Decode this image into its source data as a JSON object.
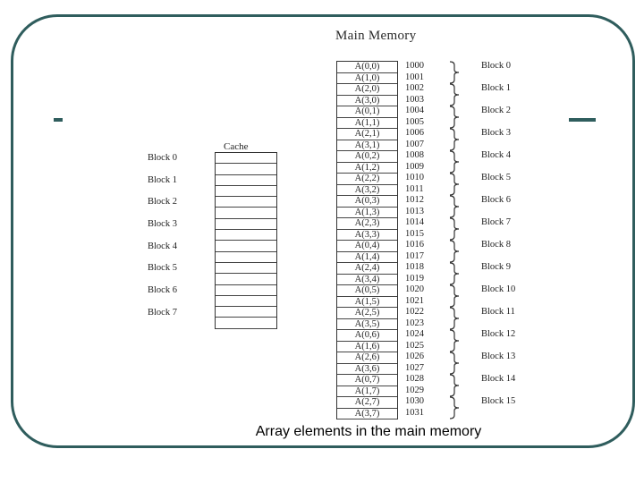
{
  "caption": "Array elements in the main memory",
  "colors": {
    "frame": "#2f5d5d",
    "text": "#222222"
  },
  "main_memory": {
    "title": "Main Memory",
    "cells": [
      {
        "element": "A(0,0)",
        "address": "1000"
      },
      {
        "element": "A(1,0)",
        "address": "1001"
      },
      {
        "element": "A(2,0)",
        "address": "1002"
      },
      {
        "element": "A(3,0)",
        "address": "1003"
      },
      {
        "element": "A(0,1)",
        "address": "1004"
      },
      {
        "element": "A(1,1)",
        "address": "1005"
      },
      {
        "element": "A(2,1)",
        "address": "1006"
      },
      {
        "element": "A(3,1)",
        "address": "1007"
      },
      {
        "element": "A(0,2)",
        "address": "1008"
      },
      {
        "element": "A(1,2)",
        "address": "1009"
      },
      {
        "element": "A(2,2)",
        "address": "1010"
      },
      {
        "element": "A(3,2)",
        "address": "1011"
      },
      {
        "element": "A(0,3)",
        "address": "1012"
      },
      {
        "element": "A(1,3)",
        "address": "1013"
      },
      {
        "element": "A(2,3)",
        "address": "1014"
      },
      {
        "element": "A(3,3)",
        "address": "1015"
      },
      {
        "element": "A(0,4)",
        "address": "1016"
      },
      {
        "element": "A(1,4)",
        "address": "1017"
      },
      {
        "element": "A(2,4)",
        "address": "1018"
      },
      {
        "element": "A(3,4)",
        "address": "1019"
      },
      {
        "element": "A(0,5)",
        "address": "1020"
      },
      {
        "element": "A(1,5)",
        "address": "1021"
      },
      {
        "element": "A(2,5)",
        "address": "1022"
      },
      {
        "element": "A(3,5)",
        "address": "1023"
      },
      {
        "element": "A(0,6)",
        "address": "1024"
      },
      {
        "element": "A(1,6)",
        "address": "1025"
      },
      {
        "element": "A(2,6)",
        "address": "1026"
      },
      {
        "element": "A(3,6)",
        "address": "1027"
      },
      {
        "element": "A(0,7)",
        "address": "1028"
      },
      {
        "element": "A(1,7)",
        "address": "1029"
      },
      {
        "element": "A(2,7)",
        "address": "1030"
      },
      {
        "element": "A(3,7)",
        "address": "1031"
      }
    ],
    "blocks": [
      "Block 0",
      "Block 1",
      "Block 2",
      "Block 3",
      "Block 4",
      "Block 5",
      "Block 6",
      "Block 7",
      "Block 8",
      "Block 9",
      "Block 10",
      "Block 11",
      "Block 12",
      "Block 13",
      "Block 14",
      "Block 15"
    ]
  },
  "cache": {
    "title": "Cache",
    "blocks": [
      "Block 0",
      "Block 1",
      "Block 2",
      "Block 3",
      "Block 4",
      "Block 5",
      "Block 6",
      "Block 7"
    ],
    "lines_per_block": 2
  }
}
